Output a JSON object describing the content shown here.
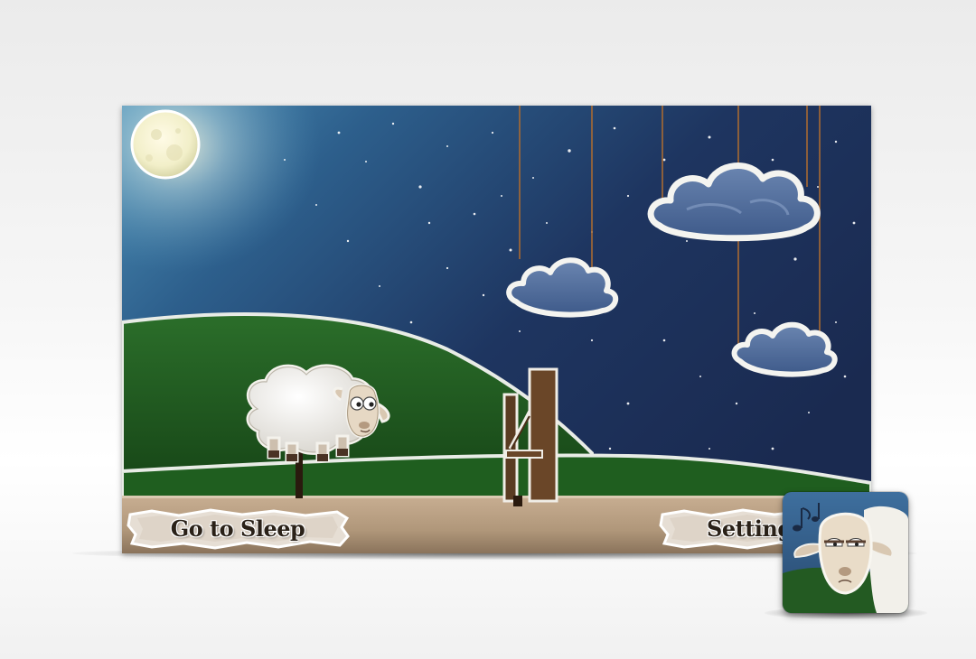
{
  "game": {
    "menu": {
      "sleep_label": "Go to Sleep",
      "settings_label": "Settings"
    }
  },
  "icons": {
    "moon": "moon-icon",
    "app": "sheep-app-icon",
    "music": "music-note-icon"
  },
  "colors": {
    "sky_dark": "#1b2a4e",
    "sky_light": "#3f7fa8",
    "hill": "#1f5a22",
    "ground": "#b39a80"
  }
}
